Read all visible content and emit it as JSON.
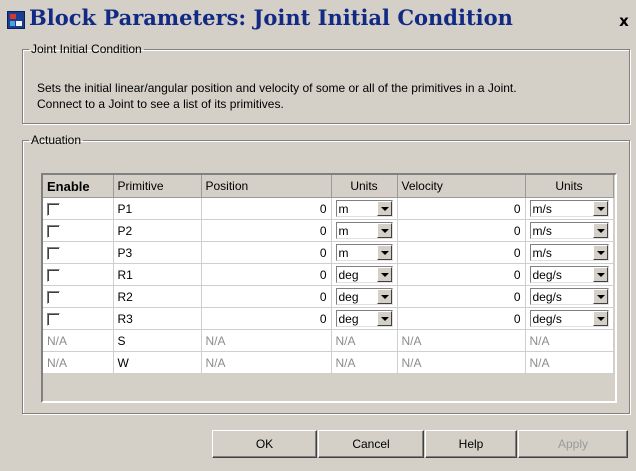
{
  "window": {
    "title": "Block Parameters: Joint Initial Condition",
    "close_glyph": "x"
  },
  "joint_group": {
    "legend": "Joint Initial Condition",
    "description_line1": "Sets the initial linear/angular position and velocity of some or all of the primitives in a Joint.",
    "description_line2": "Connect to a Joint to see a list of its primitives."
  },
  "actuation": {
    "legend": "Actuation",
    "headers": {
      "enable": "Enable",
      "primitive": "Primitive",
      "position": "Position",
      "units1": "Units",
      "velocity": "Velocity",
      "units2": "Units"
    },
    "rows": [
      {
        "primitive": "P1",
        "position": "0",
        "pos_unit": "m",
        "velocity": "0",
        "vel_unit": "m/s"
      },
      {
        "primitive": "P2",
        "position": "0",
        "pos_unit": "m",
        "velocity": "0",
        "vel_unit": "m/s"
      },
      {
        "primitive": "P3",
        "position": "0",
        "pos_unit": "m",
        "velocity": "0",
        "vel_unit": "m/s"
      },
      {
        "primitive": "R1",
        "position": "0",
        "pos_unit": "deg",
        "velocity": "0",
        "vel_unit": "deg/s"
      },
      {
        "primitive": "R2",
        "position": "0",
        "pos_unit": "deg",
        "velocity": "0",
        "vel_unit": "deg/s"
      },
      {
        "primitive": "R3",
        "position": "0",
        "pos_unit": "deg",
        "velocity": "0",
        "vel_unit": "deg/s"
      }
    ],
    "ro_rows": [
      {
        "enable": "N/A",
        "primitive": "S",
        "position": "N/A",
        "units1": "N/A",
        "velocity": "N/A",
        "units2": "N/A"
      },
      {
        "enable": "N/A",
        "primitive": "W",
        "position": "N/A",
        "units1": "N/A",
        "velocity": "N/A",
        "units2": "N/A"
      }
    ]
  },
  "buttons": {
    "ok": "OK",
    "cancel": "Cancel",
    "help": "Help",
    "apply": "Apply"
  },
  "colors": {
    "title_text": "#122a84",
    "dialog_bg": "#d4d0c8",
    "disabled_text": "#8c8c8c"
  },
  "icons": {
    "window": "simulink-block-icon",
    "close": "close-icon",
    "dropdown": "chevron-down-icon"
  }
}
